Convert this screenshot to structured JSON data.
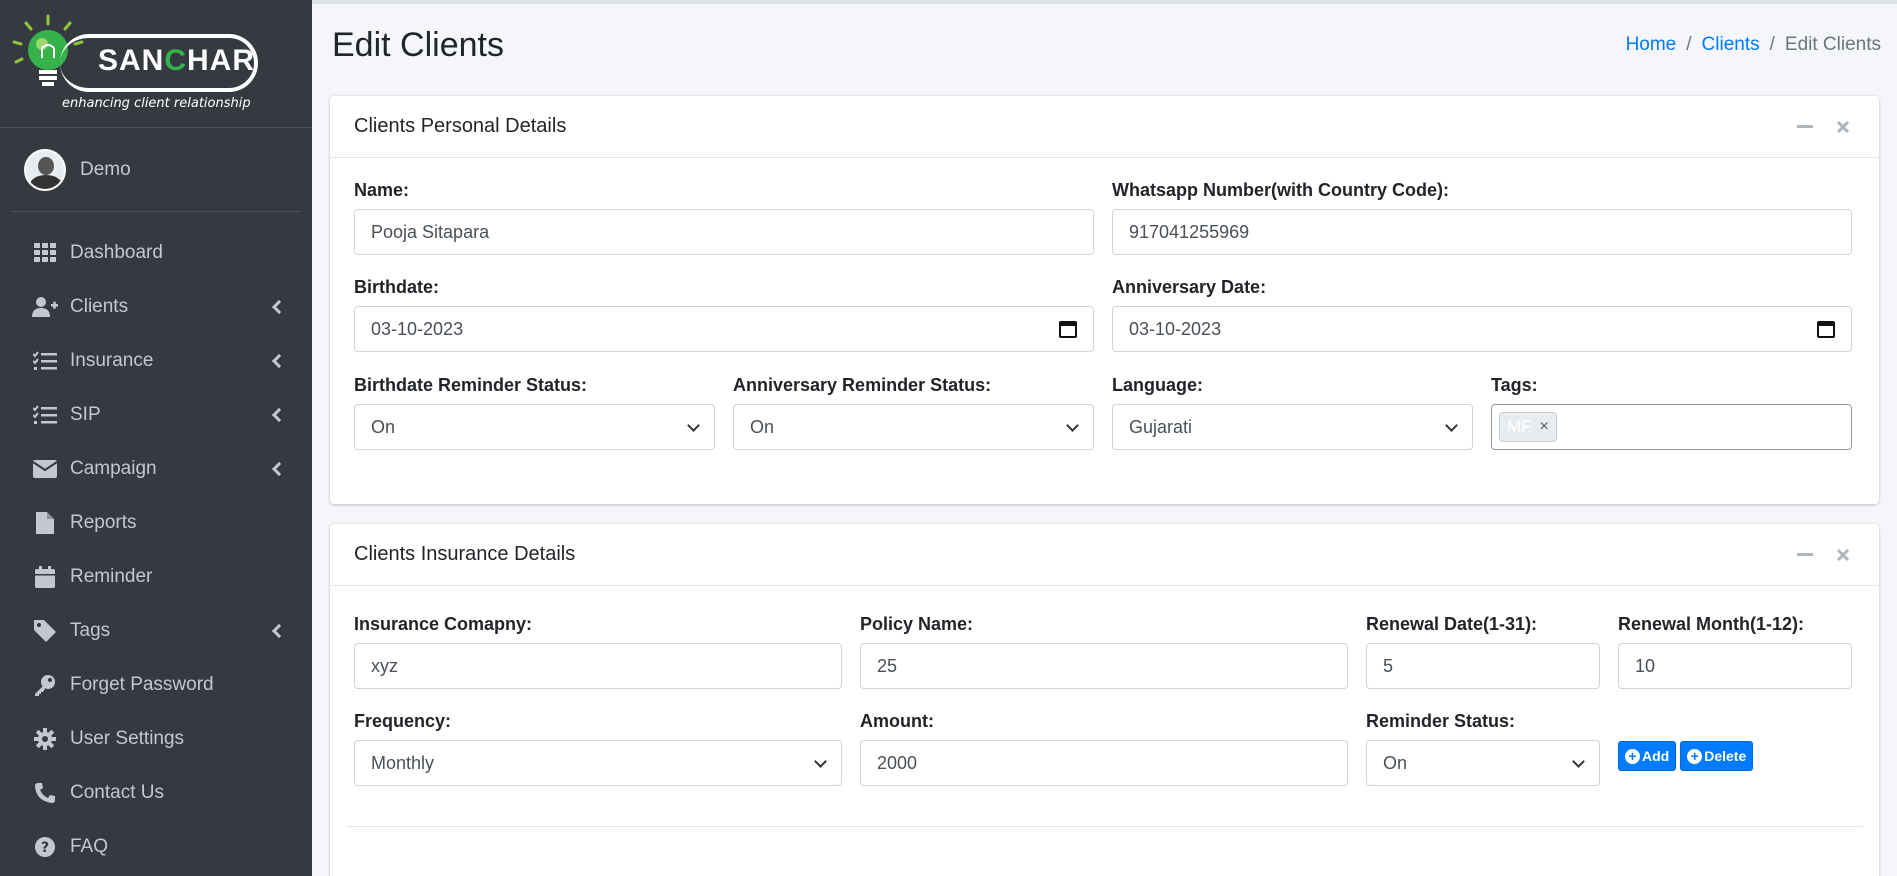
{
  "brand": {
    "logo_text_a": "SAN",
    "logo_text_c": "C",
    "logo_text_b": "HAR",
    "tagline": "enhancing client relationship"
  },
  "user": {
    "name": "Demo"
  },
  "nav": [
    {
      "label": "Dashboard",
      "icon": "grid-icon",
      "has_children": false
    },
    {
      "label": "Clients",
      "icon": "user-plus-icon",
      "has_children": true
    },
    {
      "label": "Insurance",
      "icon": "list-check-icon",
      "has_children": true
    },
    {
      "label": "SIP",
      "icon": "list-check-icon",
      "has_children": true
    },
    {
      "label": "Campaign",
      "icon": "envelope-icon",
      "has_children": true
    },
    {
      "label": "Reports",
      "icon": "file-icon",
      "has_children": false
    },
    {
      "label": "Reminder",
      "icon": "calendar-icon",
      "has_children": false
    },
    {
      "label": "Tags",
      "icon": "tag-icon",
      "has_children": true
    },
    {
      "label": "Forget Password",
      "icon": "key-icon",
      "has_children": false
    },
    {
      "label": "User Settings",
      "icon": "gear-icon",
      "has_children": false
    },
    {
      "label": "Contact Us",
      "icon": "phone-icon",
      "has_children": false
    },
    {
      "label": "FAQ",
      "icon": "question-circle-icon",
      "has_children": false
    }
  ],
  "page": {
    "title": "Edit Clients",
    "breadcrumb": [
      "Home",
      "Clients",
      "Edit Clients"
    ],
    "sep": "/"
  },
  "personal": {
    "title": "Clients Personal Details",
    "name_label": "Name:",
    "name_value": "Pooja Sitapara",
    "whatsapp_label": "Whatsapp Number(with Country Code):",
    "whatsapp_value": "917041255969",
    "birthdate_label": "Birthdate:",
    "birthdate_value": "03-10-2023",
    "anniversary_label": "Anniversary Date:",
    "anniversary_value": "03-10-2023",
    "bday_reminder_label": "Birthdate Reminder Status:",
    "bday_reminder_value": "On",
    "anniv_reminder_label": "Anniversary Reminder Status:",
    "anniv_reminder_value": "On",
    "language_label": "Language:",
    "language_value": "Gujarati",
    "tags_label": "Tags:",
    "tag_chip": "MF",
    "tag_remove": "×"
  },
  "insurance": {
    "title": "Clients Insurance Details",
    "company_label": "Insurance Comapny:",
    "company_value": "xyz",
    "policy_label": "Policy Name:",
    "policy_value": "25",
    "renewal_date_label": "Renewal Date(1-31):",
    "renewal_date_value": "5",
    "renewal_month_label": "Renewal Month(1-12):",
    "renewal_month_value": "10",
    "frequency_label": "Frequency:",
    "frequency_value": "Monthly",
    "amount_label": "Amount:",
    "amount_value": "2000",
    "reminder_label": "Reminder Status:",
    "reminder_value": "On",
    "add_label": "Add",
    "delete_label": "Delete"
  },
  "colors": {
    "sidebar": "#343a40",
    "accent": "#007bff",
    "logo_green": "#36b24a"
  }
}
